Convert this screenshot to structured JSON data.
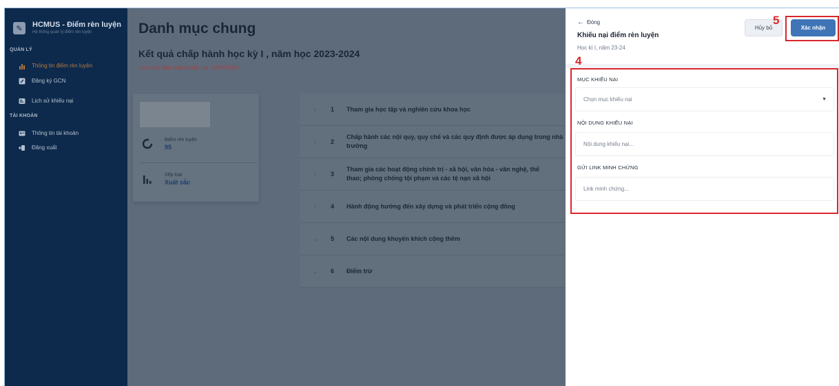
{
  "sidebar": {
    "brand_title": "HCMUS - Điểm rèn luyện",
    "brand_sub": "Hệ thống quản lý điểm rèn luyện",
    "section_manage": "QUẢN LÝ",
    "section_account": "TÀI KHOẢN",
    "items": [
      {
        "label": "Thông tin điểm rèn luyện",
        "icon": "bar-chart-icon",
        "active": true
      },
      {
        "label": "Đăng ký GCN",
        "icon": "edit-icon"
      },
      {
        "label": "Lịch sử khiếu nại",
        "icon": "history-icon"
      },
      {
        "label": "Thông tin tài khoản",
        "icon": "id-card-icon"
      },
      {
        "label": "Đăng xuất",
        "icon": "logout-icon"
      }
    ]
  },
  "main": {
    "title": "Danh mục chung",
    "subtitle": "Kết quả chấp hành học kỳ I , năm học 2023-2024",
    "deadline": "Hạn chót tiếp nhận khiếu nại: 18/09/2024",
    "stats": [
      {
        "label": "Điểm rèn luyện",
        "value": "95",
        "icon": "circle-progress-icon"
      },
      {
        "label": "Xếp loại",
        "value": "Xuất sắc",
        "icon": "bar-rank-icon"
      }
    ],
    "rows": [
      {
        "num": "1",
        "text": "Tham gia học tập và nghiên cứu khoa học",
        "expand": "›"
      },
      {
        "num": "2",
        "text": "Chấp hành các nội quy, quy chế và các quy định được áp dụng trong nhà",
        "text2": "trường",
        "expand": "›"
      },
      {
        "num": "3",
        "text": "Tham gia các hoạt động chính trị - xã hội, văn hóa - văn nghệ, thể",
        "text2": "thao; phòng chống tội phạm và các tệ nạn xã hội",
        "expand": "›"
      },
      {
        "num": "4",
        "text": "Hành động hướng đến xây dựng và phát triển cộng đồng",
        "expand": "›"
      },
      {
        "num": "5",
        "text": "Các nội dung khuyến khích cộng thêm",
        "expand": "⌄"
      },
      {
        "num": "6",
        "text": "Điểm trừ",
        "expand": "⌄"
      }
    ]
  },
  "panel": {
    "back_label": "Đóng",
    "title": "Khiếu nại điểm rèn luyện",
    "subtitle": "Học kì I, năm 23-24",
    "cancel_label": "Hủy bỏ",
    "confirm_label": "Xác nhận",
    "callout_4": "4",
    "callout_5": "5",
    "fields": [
      {
        "label": "MỤC KHIẾU NẠI",
        "placeholder": "Chọn mục khiếu nại",
        "type": "select"
      },
      {
        "label": "NỘI DUNG KHIẾU NẠI",
        "placeholder": "Nội dung khiếu nại...",
        "type": "text"
      },
      {
        "label": "GỬI LINK MINH CHỨNG",
        "placeholder": "Link minh chứng...",
        "type": "text"
      }
    ]
  },
  "colors": {
    "sidebar_bg": "#0d2a4c",
    "accent": "#3f75b7",
    "callout": "#d9262b",
    "active_item": "#b8793d"
  }
}
